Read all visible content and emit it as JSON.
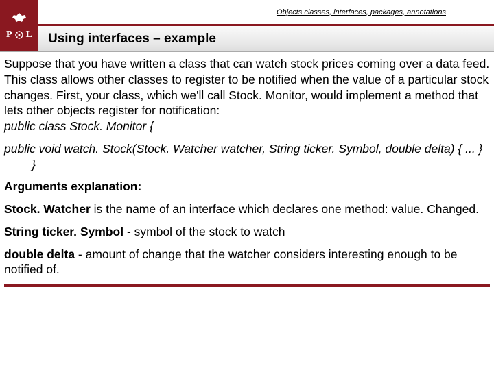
{
  "header": {
    "topline": "Objects classes, interfaces, packages, annotations",
    "logo_p": "P",
    "logo_l": "L",
    "title": "Using interfaces – example"
  },
  "body": {
    "intro": "Suppose that you have written a class that can watch stock prices coming over a data feed. This class allows other classes to register to be notified when the value of a particular stock changes. First, your class, which we'll call Stock. Monitor, would implement a method that lets other objects register for notification:",
    "class_decl": "public class Stock. Monitor {",
    "method_sig": "public void watch. Stock(Stock. Watcher watcher, String ticker. Symbol, double delta) { ... }",
    "close_brace": "}",
    "args_header": "Arguments explanation:",
    "arg1_bold": "Stock. Watcher",
    "arg1_rest": " is the name of an interface which declares one method: value. Changed.",
    "arg2_bold": "String ticker. Symbol",
    "arg2_rest": " - symbol of the stock to watch",
    "arg3_bold": "double delta",
    "arg3_rest": " - amount of change that the watcher considers interesting enough to be notified of."
  }
}
